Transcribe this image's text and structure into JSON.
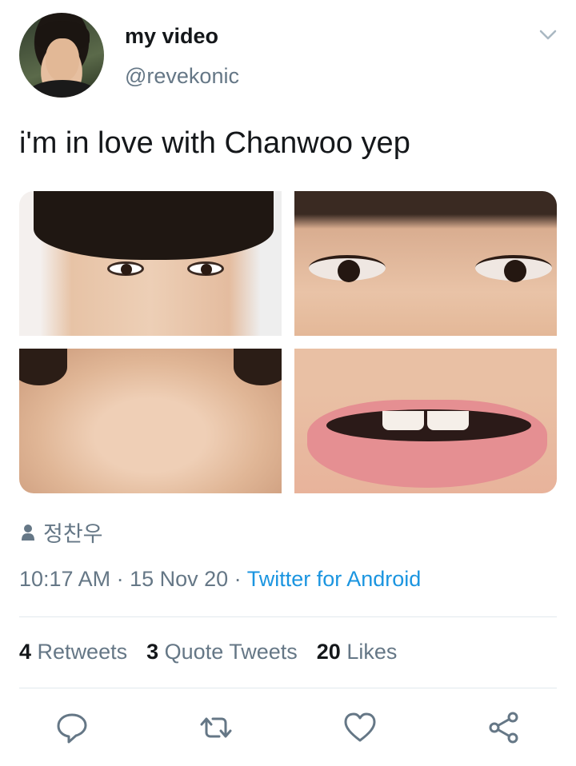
{
  "user": {
    "display_name": "my video",
    "handle": "@revekonic"
  },
  "tweet": {
    "text": "i'm in love with Chanwoo yep"
  },
  "place": {
    "label": "정찬우",
    "icon": "person-icon"
  },
  "meta": {
    "time": "10:17 AM",
    "sep1": " · ",
    "date": "15 Nov 20",
    "sep2": " · ",
    "source": "Twitter for Android"
  },
  "stats": {
    "retweets_count": "4",
    "retweets_label": "Retweets",
    "quotes_count": "3",
    "quotes_label": "Quote Tweets",
    "likes_count": "20",
    "likes_label": "Likes"
  },
  "actions": [
    "reply-icon",
    "retweet-icon",
    "like-icon",
    "share-icon"
  ],
  "colors": {
    "link": "#1b95e0",
    "secondary_text": "#657786",
    "primary_text": "#14171a",
    "divider": "#e1e8ed"
  }
}
